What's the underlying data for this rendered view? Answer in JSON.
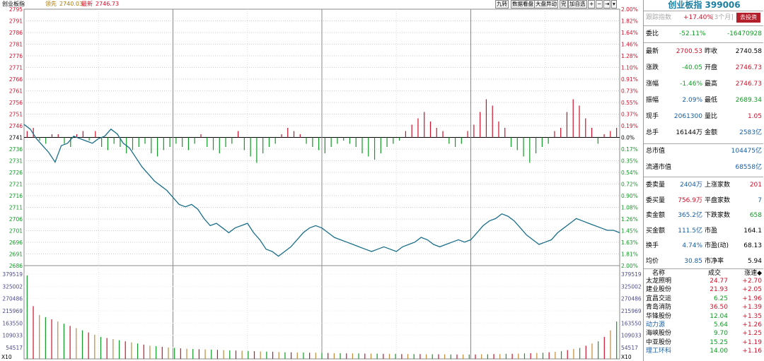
{
  "header": {
    "title": "创业板指",
    "prev_label": "领先",
    "prev_value": "2740.03",
    "latest_label": "最新",
    "latest_value": "2746.73"
  },
  "toolbar": {
    "btn_nine": "九转",
    "btn_data": "数据看盘",
    "btn_market": "大盘异动",
    "btn_complete": "完",
    "btn_add": "加自选",
    "btn_plus": "+",
    "btn_minus": "−",
    "btn_next": "⇥"
  },
  "axis": {
    "price_ticks": [
      "2795",
      "2791",
      "2786",
      "2781",
      "2776",
      "2771",
      "2766",
      "2761",
      "2756",
      "2751",
      "2746",
      "2741",
      "2736",
      "2731",
      "2726",
      "2721",
      "2716",
      "2711",
      "2706",
      "2701",
      "2696",
      "2691",
      "2686"
    ],
    "pct_ticks": [
      "2.00%",
      "1.82%",
      "1.64%",
      "1.46%",
      "1.28%",
      "1.10%",
      "0.91%",
      "0.73%",
      "0.55%",
      "0.37%",
      "0.19%",
      "0.0%",
      "0.17%",
      "0.35%",
      "0.54%",
      "0.72%",
      "0.90%",
      "1.08%",
      "1.26%",
      "1.45%",
      "1.63%",
      "1.81%",
      "2.00%"
    ],
    "vol_ticks": [
      "379519",
      "325002",
      "270486",
      "215969",
      "163550",
      "109033",
      "54517"
    ],
    "vol_unit": "X10"
  },
  "colors": {
    "up": "#d0102a",
    "down": "#119a25",
    "line": "#1a6e8a",
    "grid": "#888888",
    "title": "#1a7fa3"
  },
  "panel": {
    "title": "创业板指 399006",
    "follow_label": "跟踪指数",
    "follow_value": "+17.40%",
    "follow_period": "[3个月]",
    "relate_btn": "去投资",
    "weibi_label": "委比",
    "weibi_value": "-52.11%",
    "weicha_value": "-16470928",
    "stats": [
      {
        "l1": "最新",
        "v1": "2700.53",
        "c1": "red",
        "l2": "昨收",
        "v2": "2740.58",
        "c2": "black"
      },
      {
        "l1": "涨跌",
        "v1": "-40.05",
        "c1": "green",
        "l2": "开盘",
        "v2": "2746.73",
        "c2": "red"
      },
      {
        "l1": "涨幅",
        "v1": "-1.46%",
        "c1": "green",
        "l2": "最高",
        "v2": "2746.73",
        "c2": "red"
      },
      {
        "l1": "振幅",
        "v1": "2.09%",
        "c1": "blue",
        "l2": "最低",
        "v2": "2689.34",
        "c2": "green"
      },
      {
        "l1": "现手",
        "v1": "2061300",
        "c1": "blue",
        "l2": "量比",
        "v2": "1.05",
        "c2": "red"
      },
      {
        "l1": "总手",
        "v1": "16144万",
        "c1": "black",
        "l2": "金额",
        "v2": "2583亿",
        "c2": "blue"
      }
    ],
    "total_mv_label": "总市值",
    "total_mv_value": "104475亿",
    "float_mv_label": "流通市值",
    "float_mv_value": "68558亿",
    "stats2": [
      {
        "l1": "委卖量",
        "v1": "2404万",
        "c1": "blue",
        "l2": "上涨家数",
        "v2": "201",
        "c2": "red"
      },
      {
        "l1": "委买量",
        "v1": "756.9万",
        "c1": "red",
        "l2": "平盘家数",
        "v2": "7",
        "c2": "blue"
      },
      {
        "l1": "卖金额",
        "v1": "365.2亿",
        "c1": "blue",
        "l2": "下跌家数",
        "v2": "658",
        "c2": "green"
      },
      {
        "l1": "买金额",
        "v1": "111.5亿",
        "c1": "blue",
        "l2": "市盈",
        "v2": "164.1",
        "c2": "black"
      },
      {
        "l1": "换手",
        "v1": "4.74%",
        "c1": "blue",
        "l2": "市盈(动)",
        "v2": "68.13",
        "c2": "black"
      },
      {
        "l1": "均价",
        "v1": "30.85",
        "c1": "blue",
        "l2": "市净率",
        "v2": "5.94",
        "c2": "black"
      }
    ],
    "list_header": {
      "name": "名称",
      "price": "成交",
      "speed": "涨速◆"
    },
    "stocks": [
      {
        "name": "太龙照明",
        "price": "24.77",
        "speed": "+2.70",
        "nc": "black",
        "pc": "red"
      },
      {
        "name": "建业股份",
        "price": "21.93",
        "speed": "+2.05",
        "nc": "black",
        "pc": "red"
      },
      {
        "name": "宜昌交运",
        "price": "6.25",
        "speed": "+1.96",
        "nc": "black",
        "pc": "green"
      },
      {
        "name": "青岛消防",
        "price": "36.50",
        "speed": "+1.39",
        "nc": "black",
        "pc": "red"
      },
      {
        "name": "华锋股份",
        "price": "12.04",
        "speed": "+1.35",
        "nc": "black",
        "pc": "green"
      },
      {
        "name": "动力源",
        "price": "5.64",
        "speed": "+1.26",
        "nc": "blue",
        "pc": "green"
      },
      {
        "name": "海峡股份",
        "price": "9.70",
        "speed": "+1.25",
        "nc": "black",
        "pc": "green"
      },
      {
        "name": "中亚股份",
        "price": "15.25",
        "speed": "+1.19",
        "nc": "black",
        "pc": "green"
      },
      {
        "name": "理工环科",
        "price": "14.00",
        "speed": "+1.16",
        "nc": "blue",
        "pc": "green"
      }
    ]
  },
  "chart_data": {
    "type": "line",
    "title": "",
    "ylim": [
      2686,
      2795
    ],
    "prev_close": 2740.58,
    "price_points": [
      2746,
      2744,
      2740,
      2737,
      2734,
      2730,
      2737,
      2738,
      2741,
      2740,
      2739,
      2738,
      2740,
      2741,
      2744,
      2742,
      2738,
      2736,
      2732,
      2728,
      2725,
      2722,
      2720,
      2718,
      2715,
      2712,
      2711,
      2712,
      2710,
      2706,
      2703,
      2704,
      2702,
      2700,
      2702,
      2703,
      2704,
      2700,
      2697,
      2693,
      2692,
      2690,
      2692,
      2694,
      2697,
      2700,
      2702,
      2703,
      2702,
      2700,
      2698,
      2697,
      2696,
      2695,
      2694,
      2693,
      2692,
      2693,
      2694,
      2693,
      2692,
      2694,
      2695,
      2696,
      2698,
      2697,
      2695,
      2694,
      2695,
      2696,
      2697,
      2696,
      2697,
      2700,
      2703,
      2705,
      2706,
      2708,
      2707,
      2705,
      2702,
      2699,
      2697,
      2695,
      2696,
      2697,
      2700,
      2702,
      2704,
      2706,
      2705,
      2704,
      2703,
      2702,
      2701,
      2701,
      2700
    ],
    "bars": [
      2,
      3,
      -1,
      -2,
      1,
      1,
      -2,
      -3,
      1,
      2,
      -1,
      2,
      -3,
      -4,
      -2,
      -3,
      -5,
      -4,
      -3,
      -2,
      -5,
      -6,
      -4,
      -3,
      -2,
      -3,
      -4,
      -2,
      1,
      -3,
      -4,
      -5,
      -3,
      -2,
      2,
      -4,
      -6,
      -8,
      -5,
      -3,
      -2,
      1,
      3,
      2,
      1,
      -2,
      -3,
      -4,
      -5,
      -3,
      -2,
      -1,
      -2,
      -3,
      -5,
      -6,
      -7,
      -5,
      -3,
      -2,
      -1,
      2,
      4,
      6,
      8,
      5,
      3,
      2,
      -2,
      -3,
      -2,
      2,
      4,
      8,
      12,
      10,
      5,
      3,
      -3,
      -4,
      -6,
      -8,
      -5,
      -3,
      -2,
      2,
      3,
      8,
      12,
      10,
      6,
      3,
      -2,
      1,
      2,
      3
    ],
    "volume": [
      380000,
      240000,
      200000,
      190000,
      180000,
      170000,
      160000,
      150000,
      140000,
      130000,
      120000,
      110000,
      100000,
      95000,
      90000,
      85000,
      80000,
      75000,
      70000,
      65000,
      60000,
      58000,
      55000,
      52000,
      50000,
      48000,
      46000,
      45000,
      44000,
      43000,
      42000,
      41000,
      40000,
      39000,
      38000,
      37000,
      36000,
      35000,
      34000,
      33000,
      32000,
      31000,
      30000,
      30000,
      29000,
      29000,
      28000,
      28000,
      27000,
      27000,
      26000,
      26000,
      25000,
      25000,
      25000,
      24000,
      24000,
      24000,
      23000,
      23000,
      23000,
      22000,
      22000,
      22000,
      22000,
      21000,
      21000,
      21000,
      21000,
      20000,
      20000,
      20000,
      20000,
      20000,
      21000,
      21000,
      22000,
      22000,
      23000,
      23000,
      24000,
      25000,
      26000,
      27000,
      28000,
      30000,
      32000,
      35000,
      40000,
      45000,
      50000,
      60000,
      70000,
      80000,
      100000,
      130000,
      170000
    ]
  }
}
